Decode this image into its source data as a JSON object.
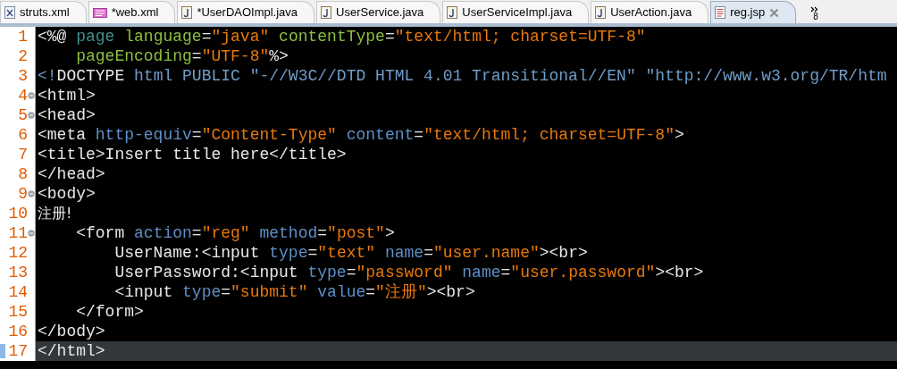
{
  "tabs": [
    {
      "label": "struts.xml",
      "kind": "xml",
      "selected": false
    },
    {
      "label": "*web.xml",
      "kind": "webxml",
      "selected": false
    },
    {
      "label": "*UserDAOImpl.java",
      "kind": "java",
      "selected": false
    },
    {
      "label": "UserService.java",
      "kind": "java",
      "selected": false
    },
    {
      "label": "UserServiceImpl.java",
      "kind": "java",
      "selected": false
    },
    {
      "label": "UserAction.java",
      "kind": "java",
      "selected": false
    },
    {
      "label": "reg.jsp",
      "kind": "jsp",
      "selected": true
    }
  ],
  "overflow": {
    "count": "8"
  },
  "lines": [
    {
      "number": "1",
      "fold": false,
      "current": false,
      "tokens": [
        {
          "kind": "punct",
          "text": "<%@ "
        },
        {
          "kind": "directive",
          "text": "page "
        },
        {
          "kind": "dattr",
          "text": "language"
        },
        {
          "kind": "punct",
          "text": "="
        },
        {
          "kind": "value",
          "text": "\"java\" "
        },
        {
          "kind": "dattr",
          "text": "contentType"
        },
        {
          "kind": "punct",
          "text": "="
        },
        {
          "kind": "value",
          "text": "\"text/html; charset=UTF-8\""
        }
      ]
    },
    {
      "number": "2",
      "fold": false,
      "current": false,
      "tokens": [
        {
          "kind": "dattr",
          "text": "    pageEncoding"
        },
        {
          "kind": "punct",
          "text": "="
        },
        {
          "kind": "value",
          "text": "\"UTF-8\""
        },
        {
          "kind": "punct",
          "text": "%>"
        }
      ]
    },
    {
      "number": "3",
      "fold": false,
      "current": false,
      "tokens": [
        {
          "kind": "doctype",
          "text": "<!"
        },
        {
          "kind": "tag",
          "text": "DOCTYPE "
        },
        {
          "kind": "doctype",
          "text": "html PUBLIC \"-//W3C//DTD HTML 4.01 Transitional//EN\" \"http://www.w3.org/TR/htm"
        }
      ]
    },
    {
      "number": "4",
      "fold": true,
      "current": false,
      "tokens": [
        {
          "kind": "tag",
          "text": "<html>"
        }
      ]
    },
    {
      "number": "5",
      "fold": true,
      "current": false,
      "tokens": [
        {
          "kind": "tag",
          "text": "<head>"
        }
      ]
    },
    {
      "number": "6",
      "fold": false,
      "current": false,
      "tokens": [
        {
          "kind": "tag",
          "text": "<meta "
        },
        {
          "kind": "attr",
          "text": "http-equiv"
        },
        {
          "kind": "punct",
          "text": "="
        },
        {
          "kind": "value",
          "text": "\"Content-Type\" "
        },
        {
          "kind": "attr",
          "text": "content"
        },
        {
          "kind": "punct",
          "text": "="
        },
        {
          "kind": "value",
          "text": "\"text/html; charset=UTF-8\""
        },
        {
          "kind": "tag",
          "text": ">"
        }
      ]
    },
    {
      "number": "7",
      "fold": false,
      "current": false,
      "tokens": [
        {
          "kind": "tag",
          "text": "<title>Insert title here</title>"
        }
      ]
    },
    {
      "number": "8",
      "fold": false,
      "current": false,
      "tokens": [
        {
          "kind": "tag",
          "text": "</head>"
        }
      ]
    },
    {
      "number": "9",
      "fold": true,
      "current": false,
      "tokens": [
        {
          "kind": "tag",
          "text": "<body>"
        }
      ]
    },
    {
      "number": "10",
      "fold": false,
      "current": false,
      "tokens": [
        {
          "kind": "cjk",
          "text": "注册!"
        }
      ]
    },
    {
      "number": "11",
      "fold": true,
      "current": false,
      "tokens": [
        {
          "kind": "tag",
          "text": "    <form "
        },
        {
          "kind": "attr",
          "text": "action"
        },
        {
          "kind": "punct",
          "text": "="
        },
        {
          "kind": "value",
          "text": "\"reg\" "
        },
        {
          "kind": "attr",
          "text": "method"
        },
        {
          "kind": "punct",
          "text": "="
        },
        {
          "kind": "value",
          "text": "\"post\""
        },
        {
          "kind": "tag",
          "text": ">"
        }
      ]
    },
    {
      "number": "12",
      "fold": false,
      "current": false,
      "tokens": [
        {
          "kind": "tag",
          "text": "        UserName:<input "
        },
        {
          "kind": "attr",
          "text": "type"
        },
        {
          "kind": "punct",
          "text": "="
        },
        {
          "kind": "value",
          "text": "\"text\" "
        },
        {
          "kind": "attr",
          "text": "name"
        },
        {
          "kind": "punct",
          "text": "="
        },
        {
          "kind": "value",
          "text": "\"user.name\""
        },
        {
          "kind": "tag",
          "text": "><br>"
        }
      ]
    },
    {
      "number": "13",
      "fold": false,
      "current": false,
      "tokens": [
        {
          "kind": "tag",
          "text": "        UserPassword:<input "
        },
        {
          "kind": "attr",
          "text": "type"
        },
        {
          "kind": "punct",
          "text": "="
        },
        {
          "kind": "value",
          "text": "\"password\" "
        },
        {
          "kind": "attr",
          "text": "name"
        },
        {
          "kind": "punct",
          "text": "="
        },
        {
          "kind": "value",
          "text": "\"user.password\""
        },
        {
          "kind": "tag",
          "text": "><br>"
        }
      ]
    },
    {
      "number": "14",
      "fold": false,
      "current": false,
      "tokens": [
        {
          "kind": "tag",
          "text": "        <input "
        },
        {
          "kind": "attr",
          "text": "type"
        },
        {
          "kind": "punct",
          "text": "="
        },
        {
          "kind": "value",
          "text": "\"submit\" "
        },
        {
          "kind": "attr",
          "text": "value"
        },
        {
          "kind": "punct",
          "text": "="
        },
        {
          "kind": "value",
          "text": "\"注册\""
        },
        {
          "kind": "tag",
          "text": "><br>"
        }
      ]
    },
    {
      "number": "15",
      "fold": false,
      "current": false,
      "tokens": [
        {
          "kind": "tag",
          "text": "    </form>"
        }
      ]
    },
    {
      "number": "16",
      "fold": false,
      "current": false,
      "tokens": [
        {
          "kind": "tag",
          "text": "</body>"
        }
      ]
    },
    {
      "number": "17",
      "fold": false,
      "current": true,
      "tokens": [
        {
          "kind": "tag",
          "text": "</html>"
        }
      ]
    }
  ]
}
